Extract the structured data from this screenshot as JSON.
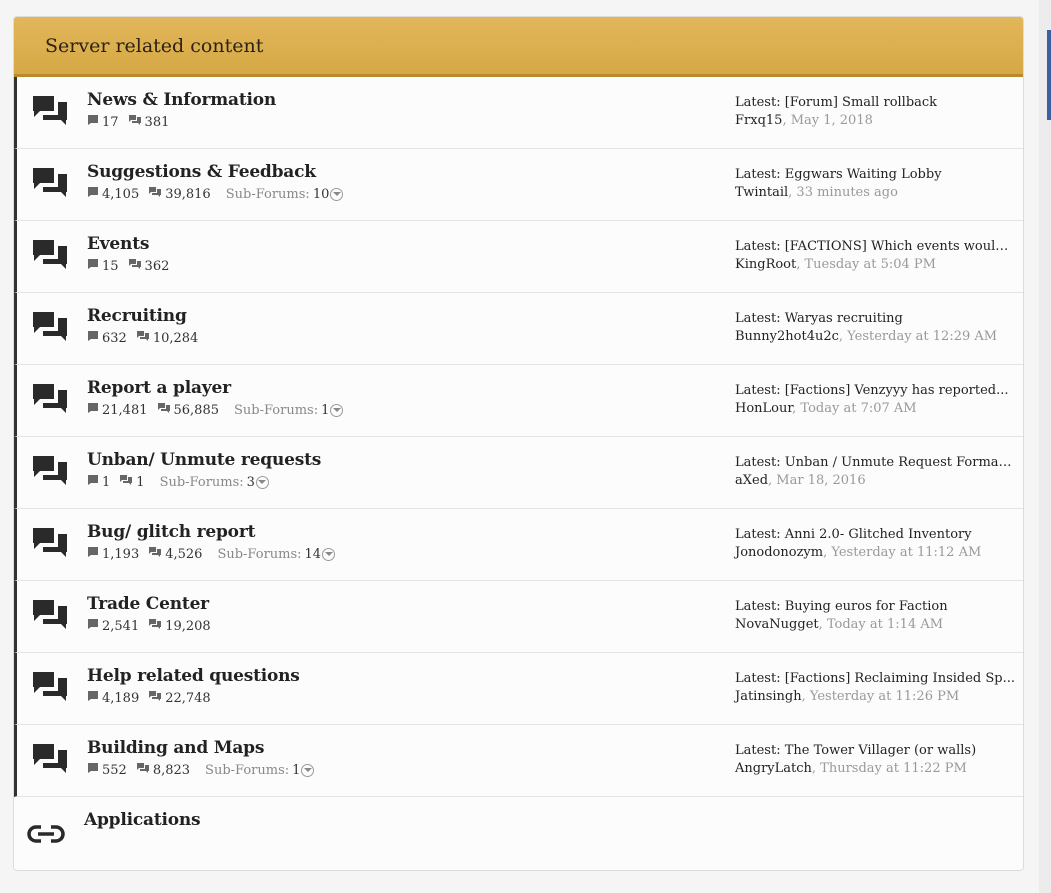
{
  "section": {
    "title": "Server related content"
  },
  "icons": {
    "forum": "chat-bubbles-icon",
    "link": "link-icon",
    "threads": "thread-icon",
    "messages": "messages-icon",
    "chevron": "chevron-down-icon"
  },
  "colors": {
    "header": "#dcaf4f",
    "border_accent": "#333333",
    "muted": "#999999"
  },
  "forums": [
    {
      "title": "News & Information",
      "threads": "17",
      "messages": "381",
      "subforums_label": "",
      "subforums_count": "",
      "latest_prefix": "Latest: ",
      "latest_thread": "[Forum] Small rollback",
      "latest_user": "Frxq15",
      "latest_time": "May 1, 2018"
    },
    {
      "title": "Suggestions & Feedback",
      "threads": "4,105",
      "messages": "39,816",
      "subforums_label": "Sub-Forums:",
      "subforums_count": "10",
      "latest_prefix": "Latest: ",
      "latest_thread": "Eggwars Waiting Lobby",
      "latest_user": "Twintail",
      "latest_time": "33 minutes ago"
    },
    {
      "title": "Events",
      "threads": "15",
      "messages": "362",
      "subforums_label": "",
      "subforums_count": "",
      "latest_prefix": "Latest: ",
      "latest_thread": "[FACTIONS] Which events would...",
      "latest_user": "KingRoot",
      "latest_time": "Tuesday at 5:04 PM"
    },
    {
      "title": "Recruiting",
      "threads": "632",
      "messages": "10,284",
      "subforums_label": "",
      "subforums_count": "",
      "latest_prefix": "Latest: ",
      "latest_thread": "Waryas recruiting",
      "latest_user": "Bunny2hot4u2c",
      "latest_time": "Yesterday at 12:29 AM"
    },
    {
      "title": "Report a player",
      "threads": "21,481",
      "messages": "56,885",
      "subforums_label": "Sub-Forums:",
      "subforums_count": "1",
      "latest_prefix": "Latest: ",
      "latest_thread": "[Factions] Venzyyy has reported...",
      "latest_user": "HonLour",
      "latest_time": "Today at 7:07 AM"
    },
    {
      "title": "Unban/ Unmute requests",
      "threads": "1",
      "messages": "1",
      "subforums_label": "Sub-Forums:",
      "subforums_count": "3",
      "latest_prefix": "Latest: ",
      "latest_thread": "Unban / Unmute Request Format...",
      "latest_user": "aXed",
      "latest_time": "Mar 18, 2016"
    },
    {
      "title": "Bug/ glitch report",
      "threads": "1,193",
      "messages": "4,526",
      "subforums_label": "Sub-Forums:",
      "subforums_count": "14",
      "latest_prefix": "Latest: ",
      "latest_thread": "Anni 2.0- Glitched Inventory",
      "latest_user": "Jonodonozym",
      "latest_time": "Yesterday at 11:12 AM"
    },
    {
      "title": "Trade Center",
      "threads": "2,541",
      "messages": "19,208",
      "subforums_label": "",
      "subforums_count": "",
      "latest_prefix": "Latest: ",
      "latest_thread": "Buying euros for Faction",
      "latest_user": "NovaNugget",
      "latest_time": "Today at 1:14 AM"
    },
    {
      "title": "Help related questions",
      "threads": "4,189",
      "messages": "22,748",
      "subforums_label": "",
      "subforums_count": "",
      "latest_prefix": "Latest: ",
      "latest_thread": "[Factions] Reclaiming Insided Sp...",
      "latest_user": "Jatinsingh",
      "latest_time": "Yesterday at 11:26 PM"
    },
    {
      "title": "Building and Maps",
      "threads": "552",
      "messages": "8,823",
      "subforums_label": "Sub-Forums:",
      "subforums_count": "1",
      "latest_prefix": "Latest: ",
      "latest_thread": "The Tower Villager (or walls)",
      "latest_user": "AngryLatch",
      "latest_time": "Thursday at 11:22 PM"
    }
  ],
  "link_forum": {
    "title": "Applications"
  }
}
